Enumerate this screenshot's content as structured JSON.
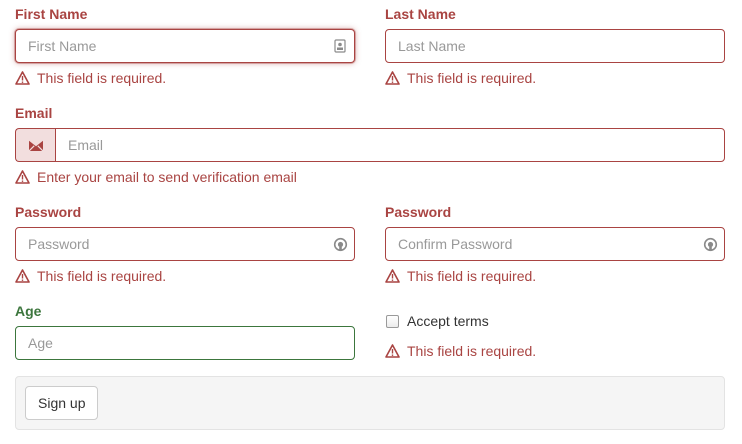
{
  "form": {
    "first_name": {
      "label": "First Name",
      "placeholder": "First Name",
      "value": "",
      "error": "This field is required.",
      "icon": "contact-card-icon"
    },
    "last_name": {
      "label": "Last Name",
      "placeholder": "Last Name",
      "value": "",
      "error": "This field is required."
    },
    "email": {
      "label": "Email",
      "placeholder": "Email",
      "value": "",
      "error": "Enter your email to send verification email",
      "icon": "envelope-icon"
    },
    "password": {
      "label": "Password",
      "placeholder": "Password",
      "value": "",
      "error": "This field is required.",
      "icon": "password-toggle-icon"
    },
    "confirm_password": {
      "label": "Password",
      "placeholder": "Confirm Password",
      "value": "",
      "error": "This field is required.",
      "icon": "password-toggle-icon"
    },
    "age": {
      "label": "Age",
      "placeholder": "Age",
      "value": ""
    },
    "terms": {
      "label": "Accept terms",
      "checked": false,
      "error": "This field is required."
    },
    "submit_label": "Sign up"
  },
  "colors": {
    "error": "#a94442",
    "error_bg": "#f2dede",
    "success": "#3c763d",
    "footer_bg": "#f5f5f5"
  }
}
